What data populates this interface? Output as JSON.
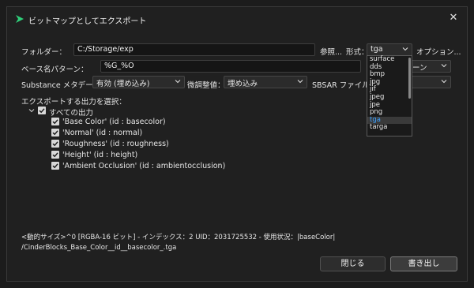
{
  "window": {
    "title": "ビットマップとしてエクスポート"
  },
  "folder": {
    "label": "フォルダー：",
    "value": "C:/Storage/exp",
    "browse": "参照...",
    "format_label": "形式：",
    "format_value": "tga",
    "options_label": "オプション..."
  },
  "basename": {
    "label": "ベース名パターン：",
    "value": "%G_%O"
  },
  "substance": {
    "label": "Substance メタデータ：",
    "value": "有効 (埋め込み)"
  },
  "fine": {
    "label": "微調整値：",
    "value": "埋め込み"
  },
  "sbsar": {
    "label": "SBSAR ファイル："
  },
  "right_combo_fragment": "ーン",
  "format_options": [
    "surface",
    "dds",
    "bmp",
    "jpg",
    "jif",
    "jpeg",
    "jpe",
    "png",
    "tga",
    "targa"
  ],
  "outputs": {
    "section_label": "エクスポートする出力を選択：",
    "all_label": "すべての出力",
    "items": [
      {
        "label": "'Base Color' (id : basecolor)"
      },
      {
        "label": "'Normal' (id : normal)"
      },
      {
        "label": "'Roughness' (id : roughness)"
      },
      {
        "label": "'Height' (id : height)"
      },
      {
        "label": "'Ambient Occlusion' (id : ambientocclusion)"
      }
    ]
  },
  "status": {
    "line1": "<動的サイズ>^0 [RGBA-16 ビット] - インデックス：2 UID：2031725532 - 使用状況：|baseColor|",
    "line2": "/CinderBlocks_Base_Color__id__basecolor_.tga"
  },
  "buttons": {
    "close": "閉じる",
    "write": "書き出し"
  },
  "colors": {
    "accent": "#3aa0ff",
    "app_icon": "#2fd07a"
  }
}
